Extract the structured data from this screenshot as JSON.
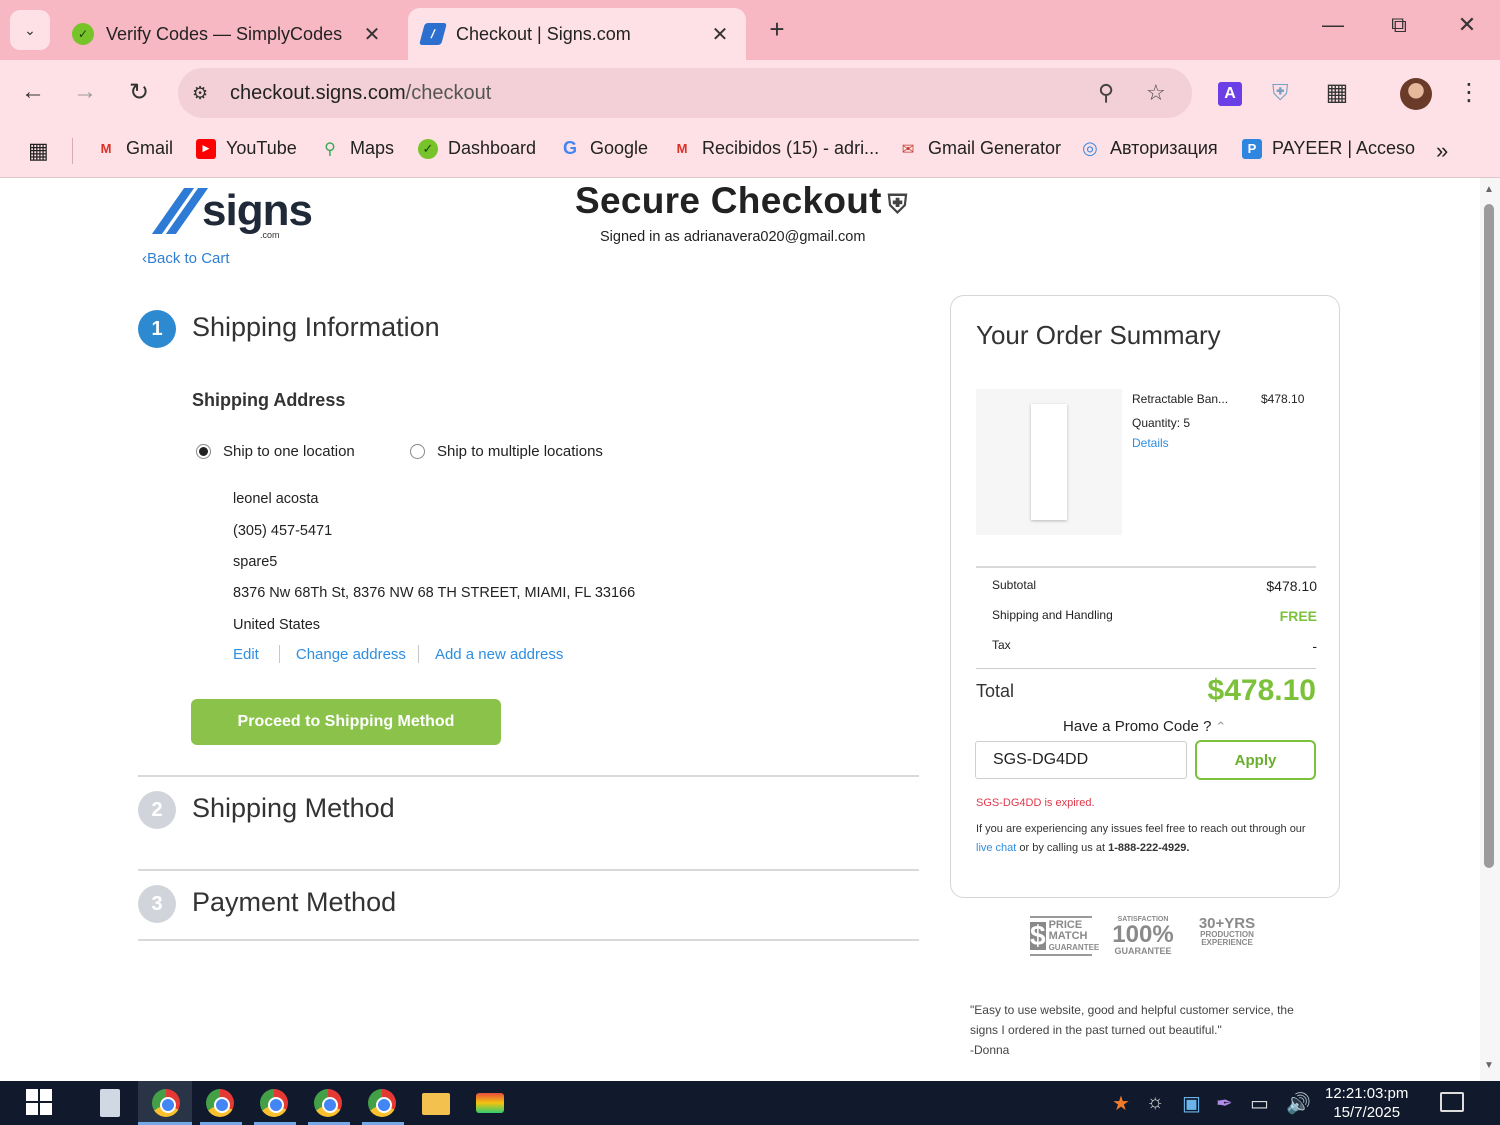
{
  "browser": {
    "tabs": [
      {
        "title": "Verify Codes — SimplyCodes",
        "active": false
      },
      {
        "title": "Checkout | Signs.com",
        "active": true
      }
    ],
    "url_domain": "checkout.signs.com",
    "url_path": "/checkout",
    "bookmarks": [
      {
        "label": "Gmail",
        "icon": "gmail-icon"
      },
      {
        "label": "YouTube",
        "icon": "youtube-icon"
      },
      {
        "label": "Maps",
        "icon": "maps-icon"
      },
      {
        "label": "Dashboard",
        "icon": "dashboard-icon"
      },
      {
        "label": "Google",
        "icon": "google-icon"
      },
      {
        "label": "Recibidos (15) - adri...",
        "icon": "gmail-icon"
      },
      {
        "label": "Gmail Generator",
        "icon": "mail-generator-icon"
      },
      {
        "label": "Авторизация",
        "icon": "auth-icon"
      },
      {
        "label": "PAYEER | Acceso",
        "icon": "payeer-icon"
      }
    ]
  },
  "page": {
    "logo_text": "signs",
    "logo_suffix": ".com",
    "back_link": "Back to Cart",
    "title": "Secure Checkout",
    "signed_in": "Signed in as adrianavera020@gmail.com",
    "steps": [
      {
        "number": "1",
        "title": "Shipping Information",
        "active": true
      },
      {
        "number": "2",
        "title": "Shipping Method",
        "active": false
      },
      {
        "number": "3",
        "title": "Payment Method",
        "active": false
      }
    ],
    "shipping_address_heading": "Shipping Address",
    "ship_options": [
      {
        "label": "Ship to one location",
        "selected": true
      },
      {
        "label": "Ship to multiple locations",
        "selected": false
      }
    ],
    "address": {
      "name": "leonel acosta",
      "phone": "(305) 457-5471",
      "company": "spare5",
      "street": "8376 Nw 68Th St, 8376 NW 68 TH STREET, MIAMI, FL 33166",
      "country": "United States"
    },
    "address_links": [
      "Edit",
      "Change address",
      "Add a new address"
    ],
    "proceed_button": "Proceed to Shipping Method"
  },
  "summary": {
    "heading": "Your Order Summary",
    "item": {
      "name": "Retractable Ban...",
      "price": "$478.10",
      "quantity": "Quantity: 5",
      "details_link": "Details"
    },
    "rows": [
      {
        "label": "Subtotal",
        "value": "$478.10"
      },
      {
        "label": "Shipping and Handling",
        "value": "FREE"
      },
      {
        "label": "Tax",
        "value": "-"
      }
    ],
    "total_label": "Total",
    "total_value": "$478.10",
    "promo_question": "Have a Promo Code ?",
    "promo_value": "SGS-DG4DD",
    "apply_button": "Apply",
    "promo_error": "SGS-DG4DD is expired.",
    "help_prefix": "If you are experiencing any issues feel free to reach out through our",
    "help_link": "live chat",
    "help_middle": "or by calling us at",
    "help_phone": "1-888-222-4929."
  },
  "badges": {
    "b1_dollar": "$",
    "b1_text1": "PRICE",
    "b1_text2": "MATCH",
    "b1_text3": "GUARANTEE",
    "b2_top": "SATISFACTION",
    "b2_big": "100%",
    "b2_bottom": "GUARANTEE",
    "b3_top": "30+YRS",
    "b3_mid": "PRODUCTION",
    "b3_bottom": "EXPERIENCE"
  },
  "testimonial": {
    "quote": "\"Easy to use website, good and helpful customer service, the signs I ordered in the past turned out beautiful.\"",
    "author": "-Donna"
  },
  "taskbar": {
    "time": "12:21:03:pm",
    "date": "15/7/2025"
  },
  "colors": {
    "accent_blue": "#2d8ad1",
    "brand_green": "#8bc34a",
    "error_red": "#e0374a",
    "chrome_pink": "#f7b8c3"
  }
}
